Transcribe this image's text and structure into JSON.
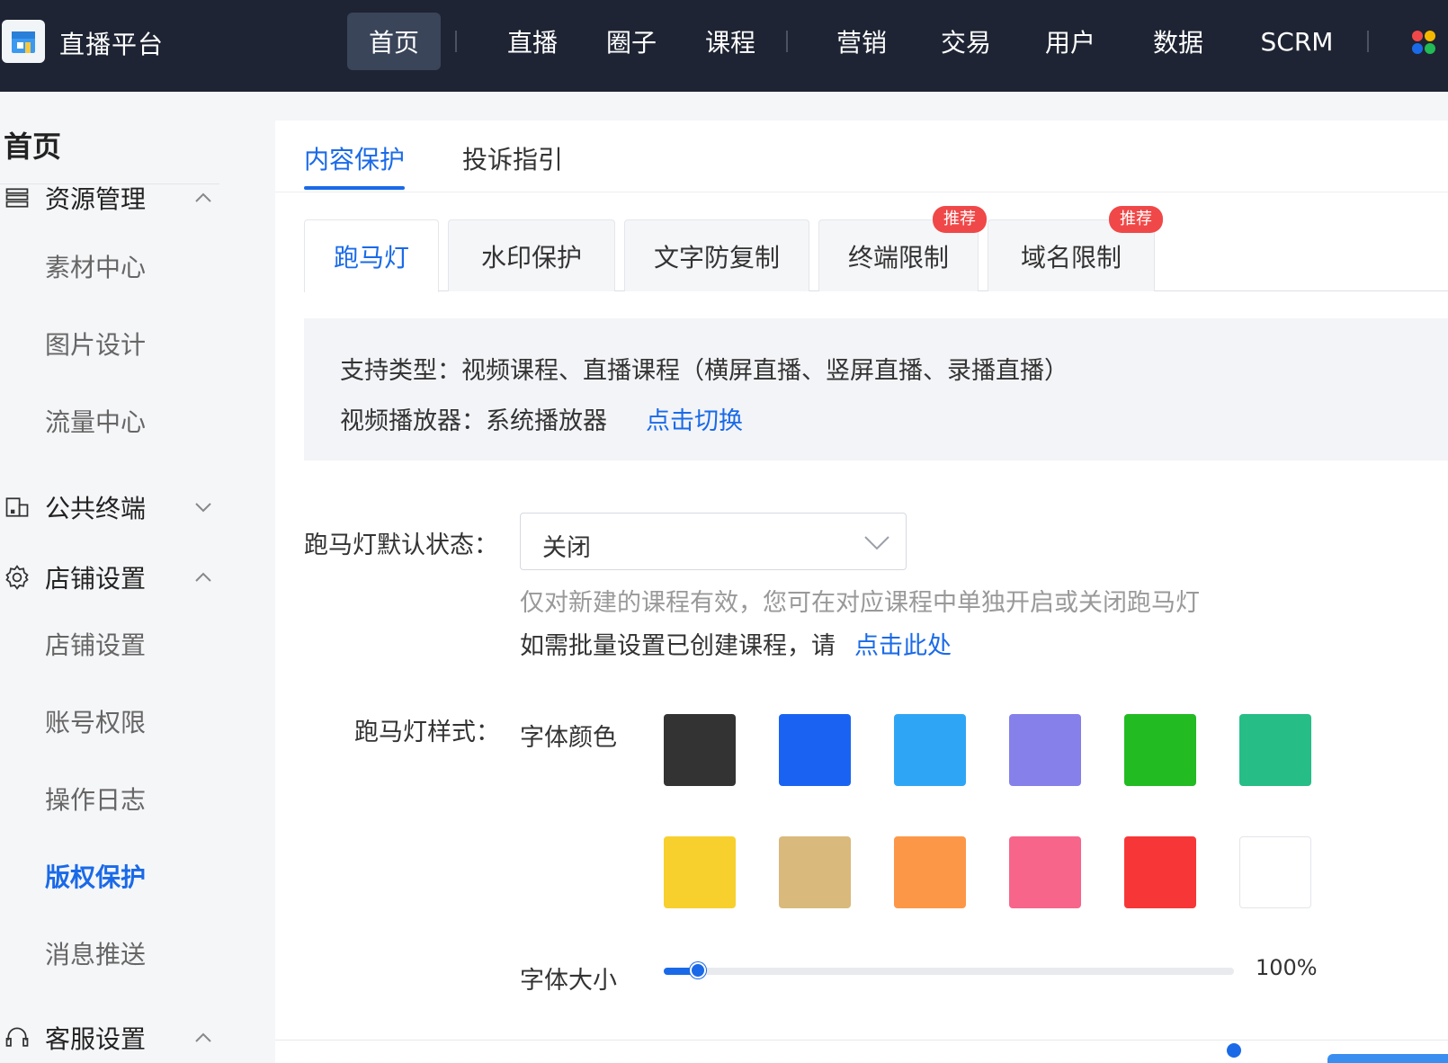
{
  "header": {
    "brand": "直播平台",
    "nav": [
      {
        "label": "首页",
        "active": true
      },
      {
        "label": "直播"
      },
      {
        "label": "圈子"
      },
      {
        "label": "课程"
      },
      {
        "label": "营销"
      },
      {
        "label": "交易"
      },
      {
        "label": "用户"
      },
      {
        "label": "数据"
      },
      {
        "label": "SCRM"
      }
    ]
  },
  "sidebar": {
    "title": "首页",
    "groups": [
      {
        "label": "资源管理",
        "icon": "resource-icon",
        "expanded": true,
        "items": [
          "素材中心",
          "图片设计",
          "流量中心"
        ]
      },
      {
        "label": "公共终端",
        "icon": "terminal-icon",
        "expanded": false,
        "items": []
      },
      {
        "label": "店铺设置",
        "icon": "gear-icon",
        "expanded": true,
        "items": [
          "店铺设置",
          "账号权限",
          "操作日志",
          "版权保护",
          "消息推送"
        ]
      },
      {
        "label": "客服设置",
        "icon": "headset-icon",
        "expanded": true,
        "items": []
      }
    ],
    "active_item": "版权保护"
  },
  "main": {
    "tabs": [
      {
        "label": "内容保护",
        "active": true
      },
      {
        "label": "投诉指引"
      }
    ],
    "subtabs": [
      {
        "label": "跑马灯",
        "active": true
      },
      {
        "label": "水印保护"
      },
      {
        "label": "文字防复制"
      },
      {
        "label": "终端限制",
        "badge": "推荐"
      },
      {
        "label": "域名限制",
        "badge": "推荐"
      }
    ],
    "info": {
      "support": "支持类型：视频课程、直播课程（横屏直播、竖屏直播、录播直播）",
      "player": "视频播放器：系统播放器",
      "switch_link": "点击切换"
    },
    "form": {
      "default_state_label": "跑马灯默认状态：",
      "default_state_value": "关闭",
      "hint1": "仅对新建的课程有效，您可在对应课程中单独开启或关闭跑马灯",
      "hint2": "如需批量设置已创建课程，请",
      "hint2_link": "点击此处",
      "style_label": "跑马灯样式：",
      "font_color_label": "字体颜色",
      "colors": [
        "#333333",
        "#1a63f2",
        "#2fa6f5",
        "#8580ea",
        "#22bb22",
        "#26bd86",
        "#f7d02e",
        "#d9b97c",
        "#fd9748",
        "#f7658a",
        "#f73737",
        "#ffffff"
      ],
      "font_size_label": "字体大小",
      "font_size_value": "100%",
      "font_size_fraction": 0.06
    }
  }
}
